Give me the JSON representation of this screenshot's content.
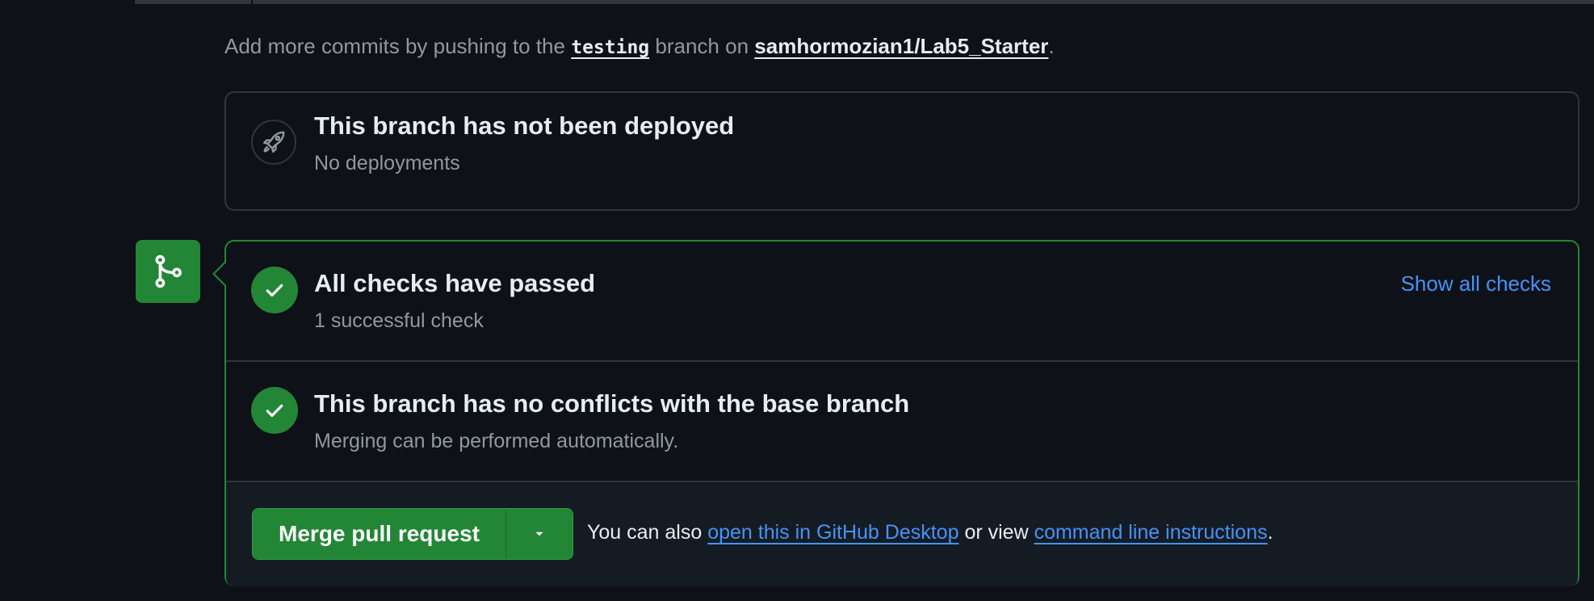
{
  "hint": {
    "prefix": "Add more commits by pushing to the",
    "branch": "testing",
    "middle": "branch on",
    "repo": "samhormozian1/Lab5_Starter",
    "suffix": "."
  },
  "deployment": {
    "icon": "rocket-icon",
    "title": "This branch has not been deployed",
    "subtitle": "No deployments"
  },
  "merge_badge": {
    "icon": "git-merge-icon",
    "color": "#238636"
  },
  "checks": {
    "icon": "check-icon",
    "title": "All checks have passed",
    "subtitle": "1 successful check",
    "show_all_label": "Show all checks"
  },
  "conflicts": {
    "icon": "check-icon",
    "title": "This branch has no conflicts with the base branch",
    "subtitle": "Merging can be performed automatically."
  },
  "merge_action": {
    "button_label": "Merge pull request",
    "dropdown_icon": "triangle-down-icon",
    "text_prefix": "You can also",
    "desktop_link": "open this in GitHub Desktop",
    "text_middle": "or view",
    "cli_link": "command line instructions",
    "text_suffix": "."
  },
  "colors": {
    "background": "#0e1117",
    "success": "#238636",
    "link": "#4493f8",
    "border": "#30363d",
    "muted_text": "#9198a1"
  }
}
